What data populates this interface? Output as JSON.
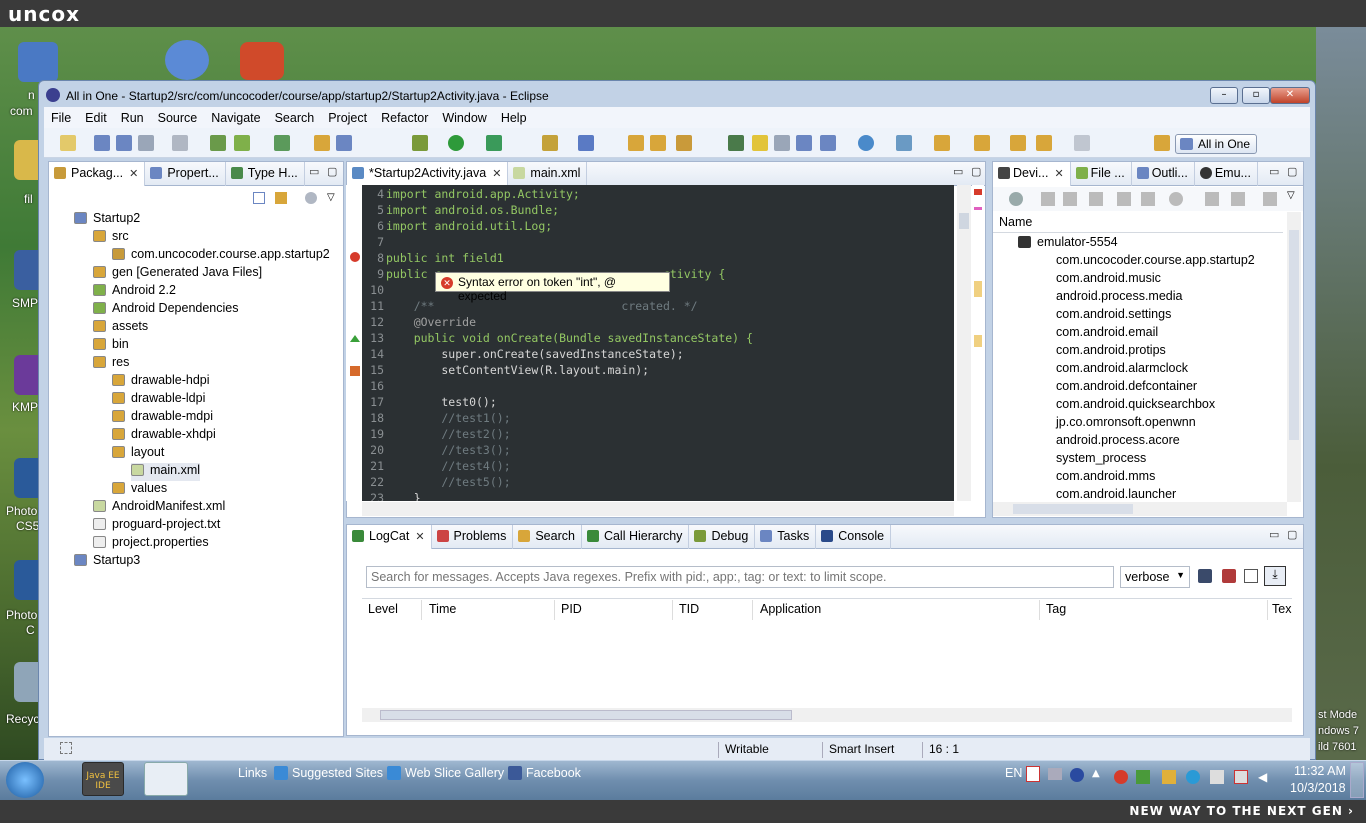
{
  "brand": "uncox",
  "footer_tagline": "NEW WAY TO THE NEXT GEN ›",
  "desktop": {
    "labels": [
      "n",
      "com",
      "fil",
      "SMP",
      "KMP",
      "Photo",
      "CS5",
      "Photo",
      "C",
      "Recycl"
    ],
    "right_text": [
      "st Mode",
      "ndows 7",
      "ild 7601"
    ]
  },
  "window": {
    "title": "All in One - Startup2/src/com/uncocoder/course/app/startup2/Startup2Activity.java - Eclipse"
  },
  "menu": [
    "File",
    "Edit",
    "Run",
    "Source",
    "Navigate",
    "Search",
    "Project",
    "Refactor",
    "Window",
    "Help"
  ],
  "perspective": "All in One",
  "package_tabs": [
    {
      "label": "Packag...",
      "x": true
    },
    {
      "label": "Propert..."
    },
    {
      "label": "Type H..."
    }
  ],
  "tree": [
    {
      "label": "Startup2",
      "level": 0
    },
    {
      "label": "src",
      "level": 1
    },
    {
      "label": "com.uncocoder.course.app.startup2",
      "level": 2
    },
    {
      "label": "gen [Generated Java Files]",
      "level": 1
    },
    {
      "label": "Android 2.2",
      "level": 1
    },
    {
      "label": "Android Dependencies",
      "level": 1
    },
    {
      "label": "assets",
      "level": 1
    },
    {
      "label": "bin",
      "level": 1
    },
    {
      "label": "res",
      "level": 1
    },
    {
      "label": "drawable-hdpi",
      "level": 2
    },
    {
      "label": "drawable-ldpi",
      "level": 2
    },
    {
      "label": "drawable-mdpi",
      "level": 2
    },
    {
      "label": "drawable-xhdpi",
      "level": 2
    },
    {
      "label": "layout",
      "level": 2
    },
    {
      "label": "main.xml",
      "level": 3
    },
    {
      "label": "values",
      "level": 2
    },
    {
      "label": "AndroidManifest.xml",
      "level": 1
    },
    {
      "label": "proguard-project.txt",
      "level": 1
    },
    {
      "label": "project.properties",
      "level": 1
    },
    {
      "label": "Startup3",
      "level": 0
    }
  ],
  "editor_tabs": [
    {
      "label": "*Startup2Activity.java"
    },
    {
      "label": "main.xml"
    }
  ],
  "code": [
    {
      "n": "4",
      "t": "import android.app.Activity;"
    },
    {
      "n": "5",
      "t": "import android.os.Bundle;"
    },
    {
      "n": "6",
      "t": "import android.util.Log;"
    },
    {
      "n": "7",
      "t": ""
    },
    {
      "n": "8",
      "t": "public int field1"
    },
    {
      "n": "9",
      "t": "public c                                ctivity {"
    },
    {
      "n": "10",
      "t": ""
    },
    {
      "n": "11",
      "t": "    /**                           created. */"
    },
    {
      "n": "12",
      "t": "    @Override"
    },
    {
      "n": "13",
      "t": "    public void onCreate(Bundle savedInstanceState) {"
    },
    {
      "n": "14",
      "t": "        super.onCreate(savedInstanceState);"
    },
    {
      "n": "15",
      "t": "        setContentView(R.layout.main);"
    },
    {
      "n": "16",
      "t": ""
    },
    {
      "n": "17",
      "t": "        test0();"
    },
    {
      "n": "18",
      "t": "        //test1();"
    },
    {
      "n": "19",
      "t": "        //test2();"
    },
    {
      "n": "20",
      "t": "        //test3();"
    },
    {
      "n": "21",
      "t": "        //test4();"
    },
    {
      "n": "22",
      "t": "        //test5();"
    },
    {
      "n": "23",
      "t": "    }"
    }
  ],
  "tooltip": "Syntax error on token \"int\", @ expected",
  "devices_tabs": [
    {
      "label": "Devi..."
    },
    {
      "label": "File ..."
    },
    {
      "label": "Outli..."
    },
    {
      "label": "Emu..."
    }
  ],
  "devices_header": "Name",
  "devices": {
    "emulator": "emulator-5554",
    "processes": [
      "com.uncocoder.course.app.startup2",
      "com.android.music",
      "android.process.media",
      "com.android.settings",
      "com.android.email",
      "com.android.protips",
      "com.android.alarmclock",
      "com.android.defcontainer",
      "com.android.quicksearchbox",
      "jp.co.omronsoft.openwnn",
      "android.process.acore",
      "system_process",
      "com.android.mms",
      "com.android.launcher"
    ]
  },
  "bottom_tabs": [
    {
      "label": "LogCat"
    },
    {
      "label": "Problems"
    },
    {
      "label": "Search"
    },
    {
      "label": "Call Hierarchy"
    },
    {
      "label": "Debug"
    },
    {
      "label": "Tasks"
    },
    {
      "label": "Console"
    }
  ],
  "logcat": {
    "search_placeholder": "Search for messages. Accepts Java regexes. Prefix with pid:, app:, tag: or text: to limit scope.",
    "level_value": "verbose",
    "columns": [
      "Level",
      "Time",
      "PID",
      "TID",
      "Application",
      "Tag",
      "Tex"
    ]
  },
  "status": {
    "writable": "Writable",
    "insert": "Smart Insert",
    "position": "16 : 1"
  },
  "taskbar": {
    "links_label": "Links",
    "links": [
      "Suggested Sites",
      "Web Slice Gallery",
      "Facebook"
    ],
    "lang": "EN",
    "time": "11:32 AM",
    "date": "10/3/2018",
    "javaee": "Java EE IDE"
  }
}
